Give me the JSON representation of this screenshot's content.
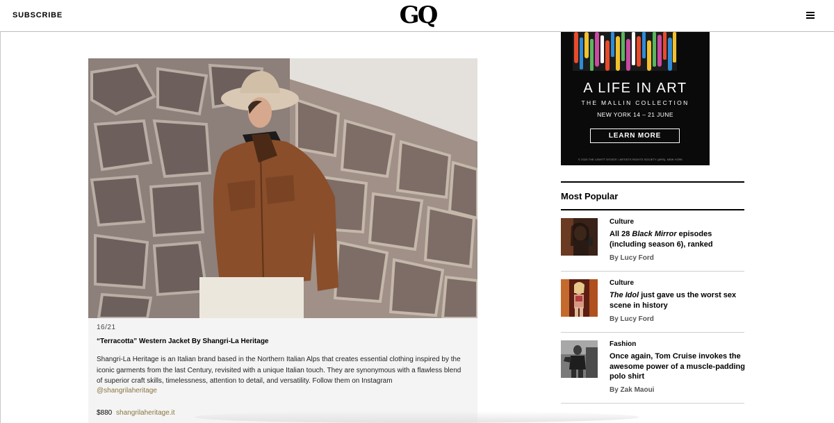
{
  "header": {
    "subscribe_label": "SUBSCRIBE",
    "logo_text": "GQ",
    "menu_icon": "hamburger-menu-icon"
  },
  "slide": {
    "counter": "16/21",
    "title": "“Terracotta” Western Jacket By Shangri-La Heritage",
    "body": "Shangri-La Heritage is an Italian brand based in the Northern Italian Alps that creates essential clothing inspired by the iconic garments from the last Century, revisited with a unique Italian touch. They are synonymous with a flawless blend of superior craft skills, timelessness, attention to detail, and versatility. Follow them on Instagram",
    "instagram_handle": "@shangrilaheritage",
    "price": "$880",
    "store_link": "shangrilaheritage.it"
  },
  "ad": {
    "title": "A LIFE IN ART",
    "subtitle": "THE MALLIN COLLECTION",
    "dates": "NEW YORK 14 – 21 JUNE",
    "button_label": "LEARN MORE",
    "fine_print": "© 2023 THE LEWITT ESTATE / ARTISTS RIGHTS SOCIETY (ARS), NEW YORK"
  },
  "most_popular": {
    "heading": "Most Popular",
    "items": [
      {
        "category": "Culture",
        "title_pre": "All 28 ",
        "title_em": "Black Mirror",
        "title_post": " episodes (including season 6), ranked",
        "byline": "By Lucy Ford"
      },
      {
        "category": "Culture",
        "title_pre": "",
        "title_em": "The Idol",
        "title_post": " just gave us the worst sex scene in history",
        "byline": "By Lucy Ford"
      },
      {
        "category": "Fashion",
        "title_pre": "",
        "title_em": "",
        "title_post": "Once again, Tom Cruise invokes the awesome power of a muscle-padding polo shirt",
        "byline": "By Zak Maoui"
      }
    ]
  },
  "colors": {
    "link_gold": "#8a7440",
    "ad_background": "#0a0a0a",
    "slide_background": "#f4f4f4"
  }
}
